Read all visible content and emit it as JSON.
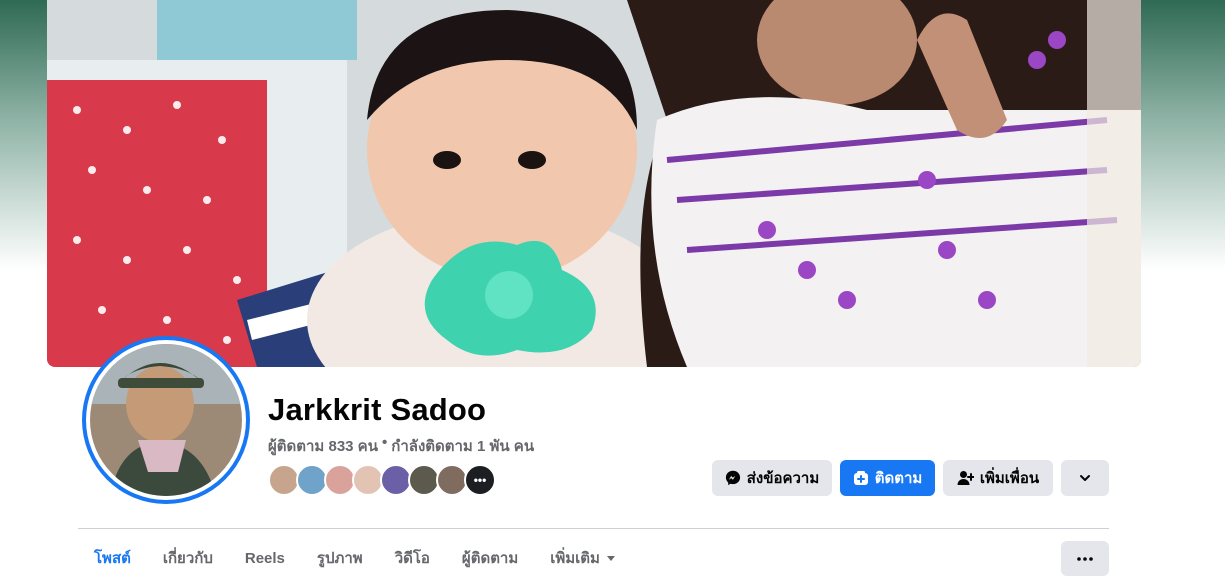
{
  "profile": {
    "name": "Jarkkrit Sadoo",
    "followers": "ผู้ติดตาม 833 คน",
    "separator": "•",
    "following": "กำลังติดตาม 1 พัน คน",
    "friends_more": "•••"
  },
  "actions": {
    "message_label": "ส่งข้อความ",
    "follow_label": "ติดตาม",
    "add_friend_label": "เพิ่มเพื่อน"
  },
  "tabs": {
    "posts": "โพสต์",
    "about": "เกี่ยวกับ",
    "reels": "Reels",
    "photos": "รูปภาพ",
    "videos": "วิดีโอ",
    "followers": "ผู้ติดตาม",
    "more": "เพิ่มเติม"
  },
  "icons": {
    "message": "messenger-icon",
    "follow": "follow-plus-icon",
    "add_friend": "add-friend-icon",
    "dropdown": "chevron-down-icon",
    "more_menu": "ellipsis-icon"
  },
  "colors": {
    "accent": "#1877f2",
    "secondary_button": "#e4e6eb",
    "muted_text": "#65676b"
  }
}
